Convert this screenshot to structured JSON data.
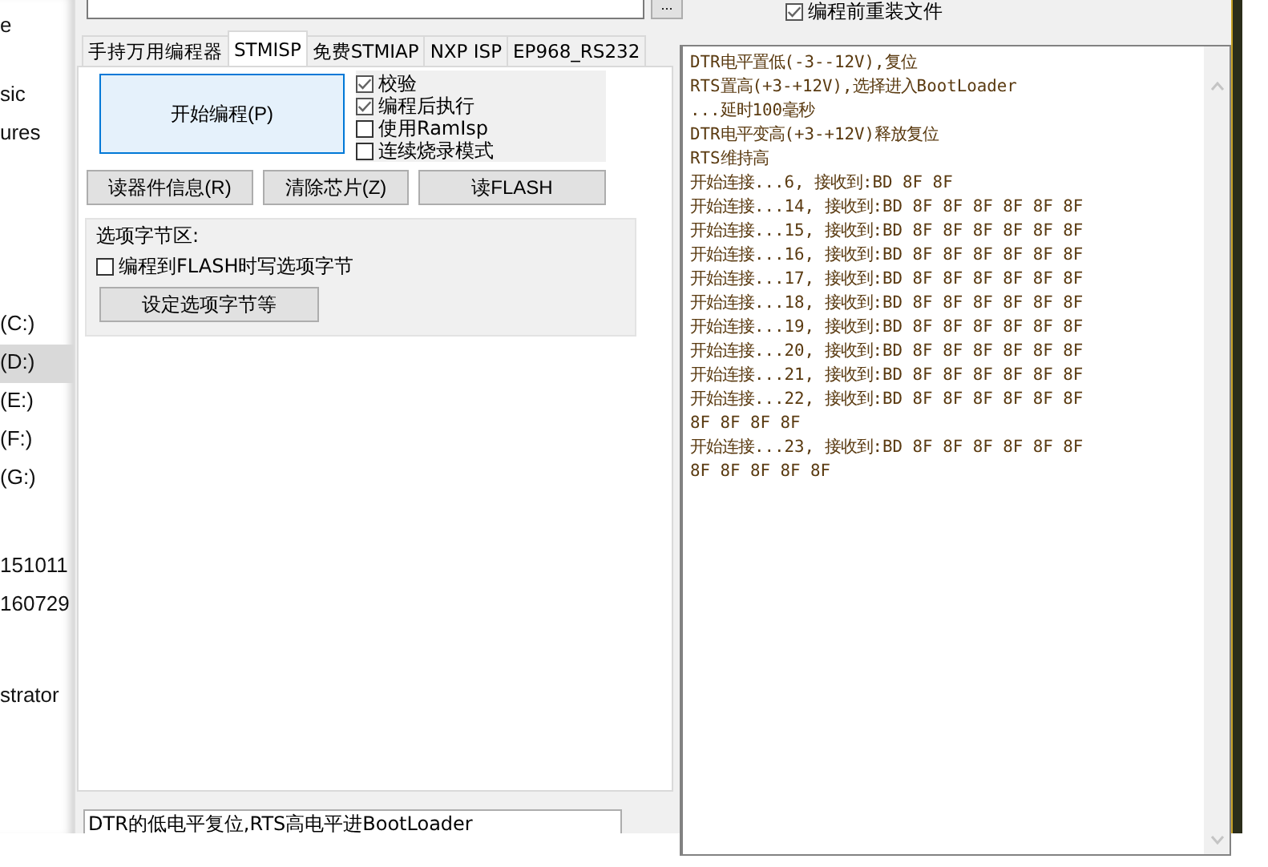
{
  "sidebar": {
    "items": [
      {
        "label": "e",
        "selected": false
      },
      {
        "label": "sic",
        "selected": false
      },
      {
        "label": "ures",
        "selected": false
      },
      {
        "label": "(C:)",
        "selected": false
      },
      {
        "label": "(D:)",
        "selected": true
      },
      {
        "label": "(E:)",
        "selected": false
      },
      {
        "label": "(F:)",
        "selected": false
      },
      {
        "label": "(G:)",
        "selected": false
      },
      {
        "label": "151011",
        "selected": false
      },
      {
        "label": "160729",
        "selected": false
      },
      {
        "label": "strator",
        "selected": false
      }
    ]
  },
  "top": {
    "browse_button": "...",
    "reload_option": {
      "label": "编程前重装文件",
      "checked": true
    }
  },
  "tabs": [
    {
      "label": "手持万用编程器",
      "selected": false
    },
    {
      "label": "STMISP",
      "selected": true
    },
    {
      "label": "免费STMIAP",
      "selected": false
    },
    {
      "label": "NXP ISP",
      "selected": false
    },
    {
      "label": "EP968_RS232",
      "selected": false
    }
  ],
  "start_button": "开始编程(P)",
  "options": [
    {
      "label": "校验",
      "checked": true
    },
    {
      "label": "编程后执行",
      "checked": true
    },
    {
      "label": "使用RamIsp",
      "checked": false
    },
    {
      "label": "连续烧录模式",
      "checked": false
    }
  ],
  "action_buttons": [
    "读器件信息(R)",
    "清除芯片(Z)",
    "读FLASH"
  ],
  "option_bytes": {
    "title": "选项字节区:",
    "write_option": {
      "label": "编程到FLASH时写选项字节",
      "checked": false
    },
    "button": "设定选项字节等"
  },
  "mode_dropdown": {
    "value": "DTR的低电平复位,RTS高电平进BootLoader"
  },
  "log": [
    "DTR电平置低(-3--12V),复位",
    "RTS置高(+3-+12V),选择进入BootLoader",
    "...延时100毫秒",
    "DTR电平变高(+3-+12V)释放复位",
    "RTS维持高",
    "开始连接...6, 接收到:BD 8F 8F",
    "开始连接...14, 接收到:BD 8F 8F 8F 8F 8F 8F",
    "开始连接...15, 接收到:BD 8F 8F 8F 8F 8F 8F",
    "开始连接...16, 接收到:BD 8F 8F 8F 8F 8F 8F",
    "开始连接...17, 接收到:BD 8F 8F 8F 8F 8F 8F",
    "开始连接...18, 接收到:BD 8F 8F 8F 8F 8F 8F",
    "开始连接...19, 接收到:BD 8F 8F 8F 8F 8F 8F",
    "开始连接...20, 接收到:BD 8F 8F 8F 8F 8F 8F",
    "开始连接...21, 接收到:BD 8F 8F 8F 8F 8F 8F",
    "开始连接...22, 接收到:BD 8F 8F 8F 8F 8F 8F",
    "8F 8F 8F 8F",
    "开始连接...23, 接收到:BD 8F 8F 8F 8F 8F 8F",
    "8F 8F 8F 8F 8F"
  ]
}
